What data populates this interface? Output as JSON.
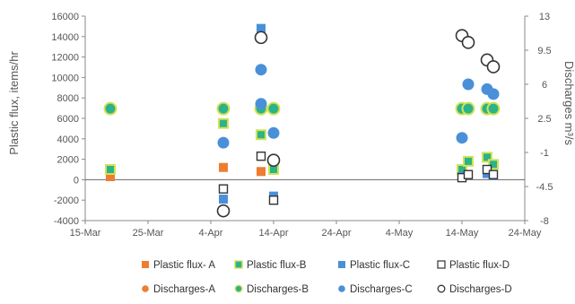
{
  "chart_data": {
    "type": "scatter",
    "title": "",
    "xlabel": "",
    "ylabel": "Plastic flux, items/hr",
    "y2label": "Discharges m³/s",
    "xlim": [
      "2018-03-15",
      "2018-05-24"
    ],
    "ylim": [
      -4000,
      16000
    ],
    "y2lim": [
      -8,
      13
    ],
    "x_tick_labels": [
      "15-Mar",
      "25-Mar",
      "4-Apr",
      "14-Apr",
      "24-Apr",
      "4-May",
      "14-May",
      "24-May"
    ],
    "y_tick_labels": [
      "-4000",
      "-2000",
      "0",
      "2000",
      "4000",
      "6000",
      "8000",
      "10000",
      "12000",
      "14000",
      "16000"
    ],
    "y2_tick_labels": [
      "-8",
      "-4.5",
      "-1",
      "2.5",
      "6",
      "9.5",
      "13"
    ],
    "grid": false,
    "legend_position": "bottom",
    "colors": {
      "A": "#ed7d31",
      "B": "#2bb38a",
      "B_edge": "#d4e157",
      "C": "#4a90d9",
      "D_face": "#ffffff",
      "D_edge": "#333333"
    },
    "series": [
      {
        "name": "Plastic flux- A",
        "axis": "left",
        "marker": "square",
        "color": "#ed7d31",
        "points": [
          [
            "2018-03-19",
            300
          ],
          [
            "2018-04-06",
            1200
          ],
          [
            "2018-04-12",
            800
          ]
        ]
      },
      {
        "name": "Plastic flux-B",
        "axis": "left",
        "marker": "square",
        "color": "#2bb38a",
        "points": [
          [
            "2018-03-19",
            1000
          ],
          [
            "2018-04-06",
            5500
          ],
          [
            "2018-04-12",
            4400
          ],
          [
            "2018-04-14",
            1000
          ],
          [
            "2018-05-14",
            1000
          ],
          [
            "2018-05-15",
            1800
          ],
          [
            "2018-05-18",
            2200
          ],
          [
            "2018-05-19",
            1500
          ]
        ]
      },
      {
        "name": "Plastic flux-C",
        "axis": "left",
        "marker": "square",
        "color": "#4a90d9",
        "points": [
          [
            "2018-04-06",
            -1900
          ],
          [
            "2018-04-12",
            14800
          ],
          [
            "2018-04-14",
            -1600
          ],
          [
            "2018-05-14",
            300
          ],
          [
            "2018-05-15",
            500
          ],
          [
            "2018-05-18",
            600
          ],
          [
            "2018-05-19",
            400
          ]
        ]
      },
      {
        "name": "Plastic flux-D",
        "axis": "left",
        "marker": "open-square",
        "color": "#333333",
        "points": [
          [
            "2018-04-06",
            -900
          ],
          [
            "2018-04-12",
            2300
          ],
          [
            "2018-04-14",
            -2000
          ],
          [
            "2018-05-14",
            200
          ],
          [
            "2018-05-15",
            500
          ],
          [
            "2018-05-18",
            1000
          ],
          [
            "2018-05-19",
            500
          ]
        ]
      },
      {
        "name": "Discharges-A",
        "axis": "right",
        "marker": "circle",
        "color": "#ed7d31",
        "points": [
          [
            "2018-03-19",
            3.5
          ],
          [
            "2018-04-06",
            3.5
          ],
          [
            "2018-04-12",
            3.5
          ],
          [
            "2018-04-14",
            3.5
          ],
          [
            "2018-05-14",
            3.5
          ],
          [
            "2018-05-15",
            3.5
          ],
          [
            "2018-05-18",
            3.5
          ],
          [
            "2018-05-19",
            3.5
          ]
        ]
      },
      {
        "name": "Discharges-B",
        "axis": "right",
        "marker": "circle",
        "color": "#2bb38a",
        "points": [
          [
            "2018-03-19",
            3.5
          ],
          [
            "2018-04-06",
            3.5
          ],
          [
            "2018-04-12",
            3.5
          ],
          [
            "2018-04-14",
            3.5
          ],
          [
            "2018-05-14",
            3.5
          ],
          [
            "2018-05-15",
            3.5
          ],
          [
            "2018-05-18",
            3.5
          ],
          [
            "2018-05-19",
            3.5
          ]
        ]
      },
      {
        "name": "Discharges-C",
        "axis": "right",
        "marker": "circle",
        "color": "#4a90d9",
        "points": [
          [
            "2018-04-06",
            0
          ],
          [
            "2018-04-12",
            7.5
          ],
          [
            "2018-04-12",
            4
          ],
          [
            "2018-04-14",
            1
          ],
          [
            "2018-05-14",
            0.5
          ],
          [
            "2018-05-15",
            6
          ],
          [
            "2018-05-18",
            5.5
          ],
          [
            "2018-05-19",
            5
          ]
        ]
      },
      {
        "name": "Discharges-D",
        "axis": "right",
        "marker": "open-circle",
        "color": "#333333",
        "points": [
          [
            "2018-04-06",
            -7
          ],
          [
            "2018-04-12",
            10.8
          ],
          [
            "2018-04-14",
            -1.8
          ],
          [
            "2018-05-14",
            11
          ],
          [
            "2018-05-15",
            10.3
          ],
          [
            "2018-05-18",
            8.5
          ],
          [
            "2018-05-19",
            7.8
          ]
        ]
      }
    ]
  }
}
